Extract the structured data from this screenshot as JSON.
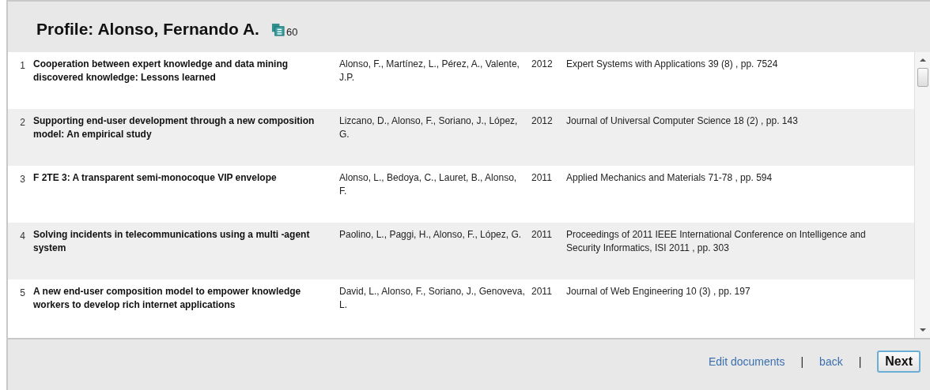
{
  "header": {
    "title": "Profile: Alonso, Fernando A.",
    "document_count": "60"
  },
  "documents": [
    {
      "number": "1",
      "title": "Cooperation between expert knowledge and data mining discovered knowledge: Lessons learned",
      "authors": "Alonso, F., Martínez, L., Pérez, A., Valente, J.P.",
      "year": "2012",
      "source": "Expert Systems with Applications 39 (8) , pp. 7524"
    },
    {
      "number": "2",
      "title": "Supporting end-user development through a new composition model: An empirical study",
      "authors": "Lizcano, D., Alonso, F., Soriano, J., López, G.",
      "year": "2012",
      "source": "Journal of Universal Computer Science 18 (2) , pp. 143"
    },
    {
      "number": "3",
      "title": "F 2TE 3: A transparent semi-monocoque VIP envelope",
      "authors": "Alonso, L., Bedoya, C., Lauret, B., Alonso, F.",
      "year": "2011",
      "source": "Applied Mechanics and Materials 71-78 , pp. 594"
    },
    {
      "number": "4",
      "title": "Solving incidents in telecommunications using a multi -agent system",
      "authors": "Paolino, L., Paggi, H., Alonso, F., López, G.",
      "year": "2011",
      "source": "Proceedings of 2011 IEEE International Conference on Intelligence and Security Informatics, ISI 2011 , pp. 303"
    },
    {
      "number": "5",
      "title": "A new end-user composition model to empower knowledge workers to develop rich internet applications",
      "authors": "David, L., Alonso, F., Soriano, J., Genoveva, L.",
      "year": "2011",
      "source": "Journal of Web Engineering 10 (3) , pp. 197"
    }
  ],
  "footer": {
    "links": [
      "Edit documents",
      "back"
    ],
    "separator": "|",
    "next_button": "Next"
  }
}
